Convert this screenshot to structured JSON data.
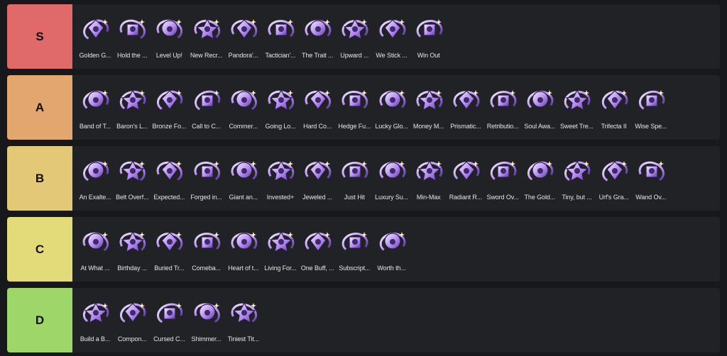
{
  "tiers": [
    {
      "label": "S",
      "color": "#e06a6a",
      "items": [
        {
          "name": "Golden G...",
          "icon": "golden-egg-icon"
        },
        {
          "name": "Hold the ...",
          "icon": "shield-hold-icon"
        },
        {
          "name": "Level Up!",
          "icon": "level-up-icon"
        },
        {
          "name": "New Recr...",
          "icon": "banner-recruit-icon"
        },
        {
          "name": "Pandora'...",
          "icon": "pandora-box-icon"
        },
        {
          "name": "Tactician'...",
          "icon": "tactician-tools-icon"
        },
        {
          "name": "The Trait ...",
          "icon": "trait-dice-icon"
        },
        {
          "name": "Upward ...",
          "icon": "upward-arrows-icon"
        },
        {
          "name": "We Stick ...",
          "icon": "stick-together-icon"
        },
        {
          "name": "Win Out",
          "icon": "win-out-icon"
        }
      ]
    },
    {
      "label": "A",
      "color": "#e3a66e",
      "items": [
        {
          "name": "Band of T...",
          "icon": "band-of-thieves-icon"
        },
        {
          "name": "Baron's L...",
          "icon": "baron-lair-icon"
        },
        {
          "name": "Bronze Fo...",
          "icon": "bronze-forever-icon"
        },
        {
          "name": "Call to C...",
          "icon": "call-to-chaos-icon"
        },
        {
          "name": "Commer...",
          "icon": "commerce-coin-icon"
        },
        {
          "name": "Going Lo...",
          "icon": "going-long-icon"
        },
        {
          "name": "Hard Co...",
          "icon": "hard-commit-icon"
        },
        {
          "name": "Hedge Fu...",
          "icon": "hedge-fund-icon"
        },
        {
          "name": "Lucky Glo...",
          "icon": "lucky-gloves-icon"
        },
        {
          "name": "Money M...",
          "icon": "money-monster-icon"
        },
        {
          "name": "Prismatic...",
          "icon": "prismatic-ticket-icon"
        },
        {
          "name": "Retributio...",
          "icon": "retribution-icon"
        },
        {
          "name": "Soul Awa...",
          "icon": "soul-awakening-icon"
        },
        {
          "name": "Sweet Tre...",
          "icon": "sweet-treats-icon"
        },
        {
          "name": "Trifecta II",
          "icon": "trifecta-icon"
        },
        {
          "name": "Wise Spe...",
          "icon": "wise-spending-icon"
        }
      ]
    },
    {
      "label": "B",
      "color": "#e3c877",
      "items": [
        {
          "name": "An Exalte...",
          "icon": "exalted-icon"
        },
        {
          "name": "Belt Overf...",
          "icon": "belt-overflow-icon"
        },
        {
          "name": "Expected...",
          "icon": "expected-dice-icon"
        },
        {
          "name": "Forged in...",
          "icon": "forged-icon"
        },
        {
          "name": "Giant an...",
          "icon": "giant-icon"
        },
        {
          "name": "Invested+",
          "icon": "invested-icon"
        },
        {
          "name": "Jeweled ...",
          "icon": "jeweled-lotus-icon"
        },
        {
          "name": "Just Hit",
          "icon": "just-hit-icon"
        },
        {
          "name": "Luxury Su...",
          "icon": "luxury-icon"
        },
        {
          "name": "Min-Max",
          "icon": "min-max-icon"
        },
        {
          "name": "Radiant R...",
          "icon": "radiant-icon"
        },
        {
          "name": "Sword Ov...",
          "icon": "sword-overflow-icon"
        },
        {
          "name": "The Gold...",
          "icon": "golden-egg-icon"
        },
        {
          "name": "Tiny, but ...",
          "icon": "tiny-icon"
        },
        {
          "name": "Urf's Gra...",
          "icon": "urf-grab-bag-icon"
        },
        {
          "name": "Wand Ov...",
          "icon": "wand-overflow-icon"
        }
      ]
    },
    {
      "label": "C",
      "color": "#e3db7a",
      "items": [
        {
          "name": "At What ...",
          "icon": "at-what-cost-icon"
        },
        {
          "name": "Birthday ...",
          "icon": "birthday-icon"
        },
        {
          "name": "Buried Tr...",
          "icon": "buried-treasure-icon"
        },
        {
          "name": "Comeba...",
          "icon": "comeback-icon"
        },
        {
          "name": "Heart of t...",
          "icon": "heart-icon"
        },
        {
          "name": "Living For...",
          "icon": "living-forge-icon"
        },
        {
          "name": "One Buff, ...",
          "icon": "one-buff-icon"
        },
        {
          "name": "Subscript...",
          "icon": "subscription-icon"
        },
        {
          "name": "Worth th...",
          "icon": "worth-the-wait-icon"
        }
      ]
    },
    {
      "label": "D",
      "color": "#9ed66a",
      "items": [
        {
          "name": "Build a B...",
          "icon": "build-a-bud-icon"
        },
        {
          "name": "Compon...",
          "icon": "component-icon"
        },
        {
          "name": "Cursed C...",
          "icon": "cursed-crown-icon"
        },
        {
          "name": "Shimmer...",
          "icon": "shimmerscale-icon"
        },
        {
          "name": "Tiniest Tit...",
          "icon": "tiniest-titan-icon"
        }
      ]
    }
  ]
}
